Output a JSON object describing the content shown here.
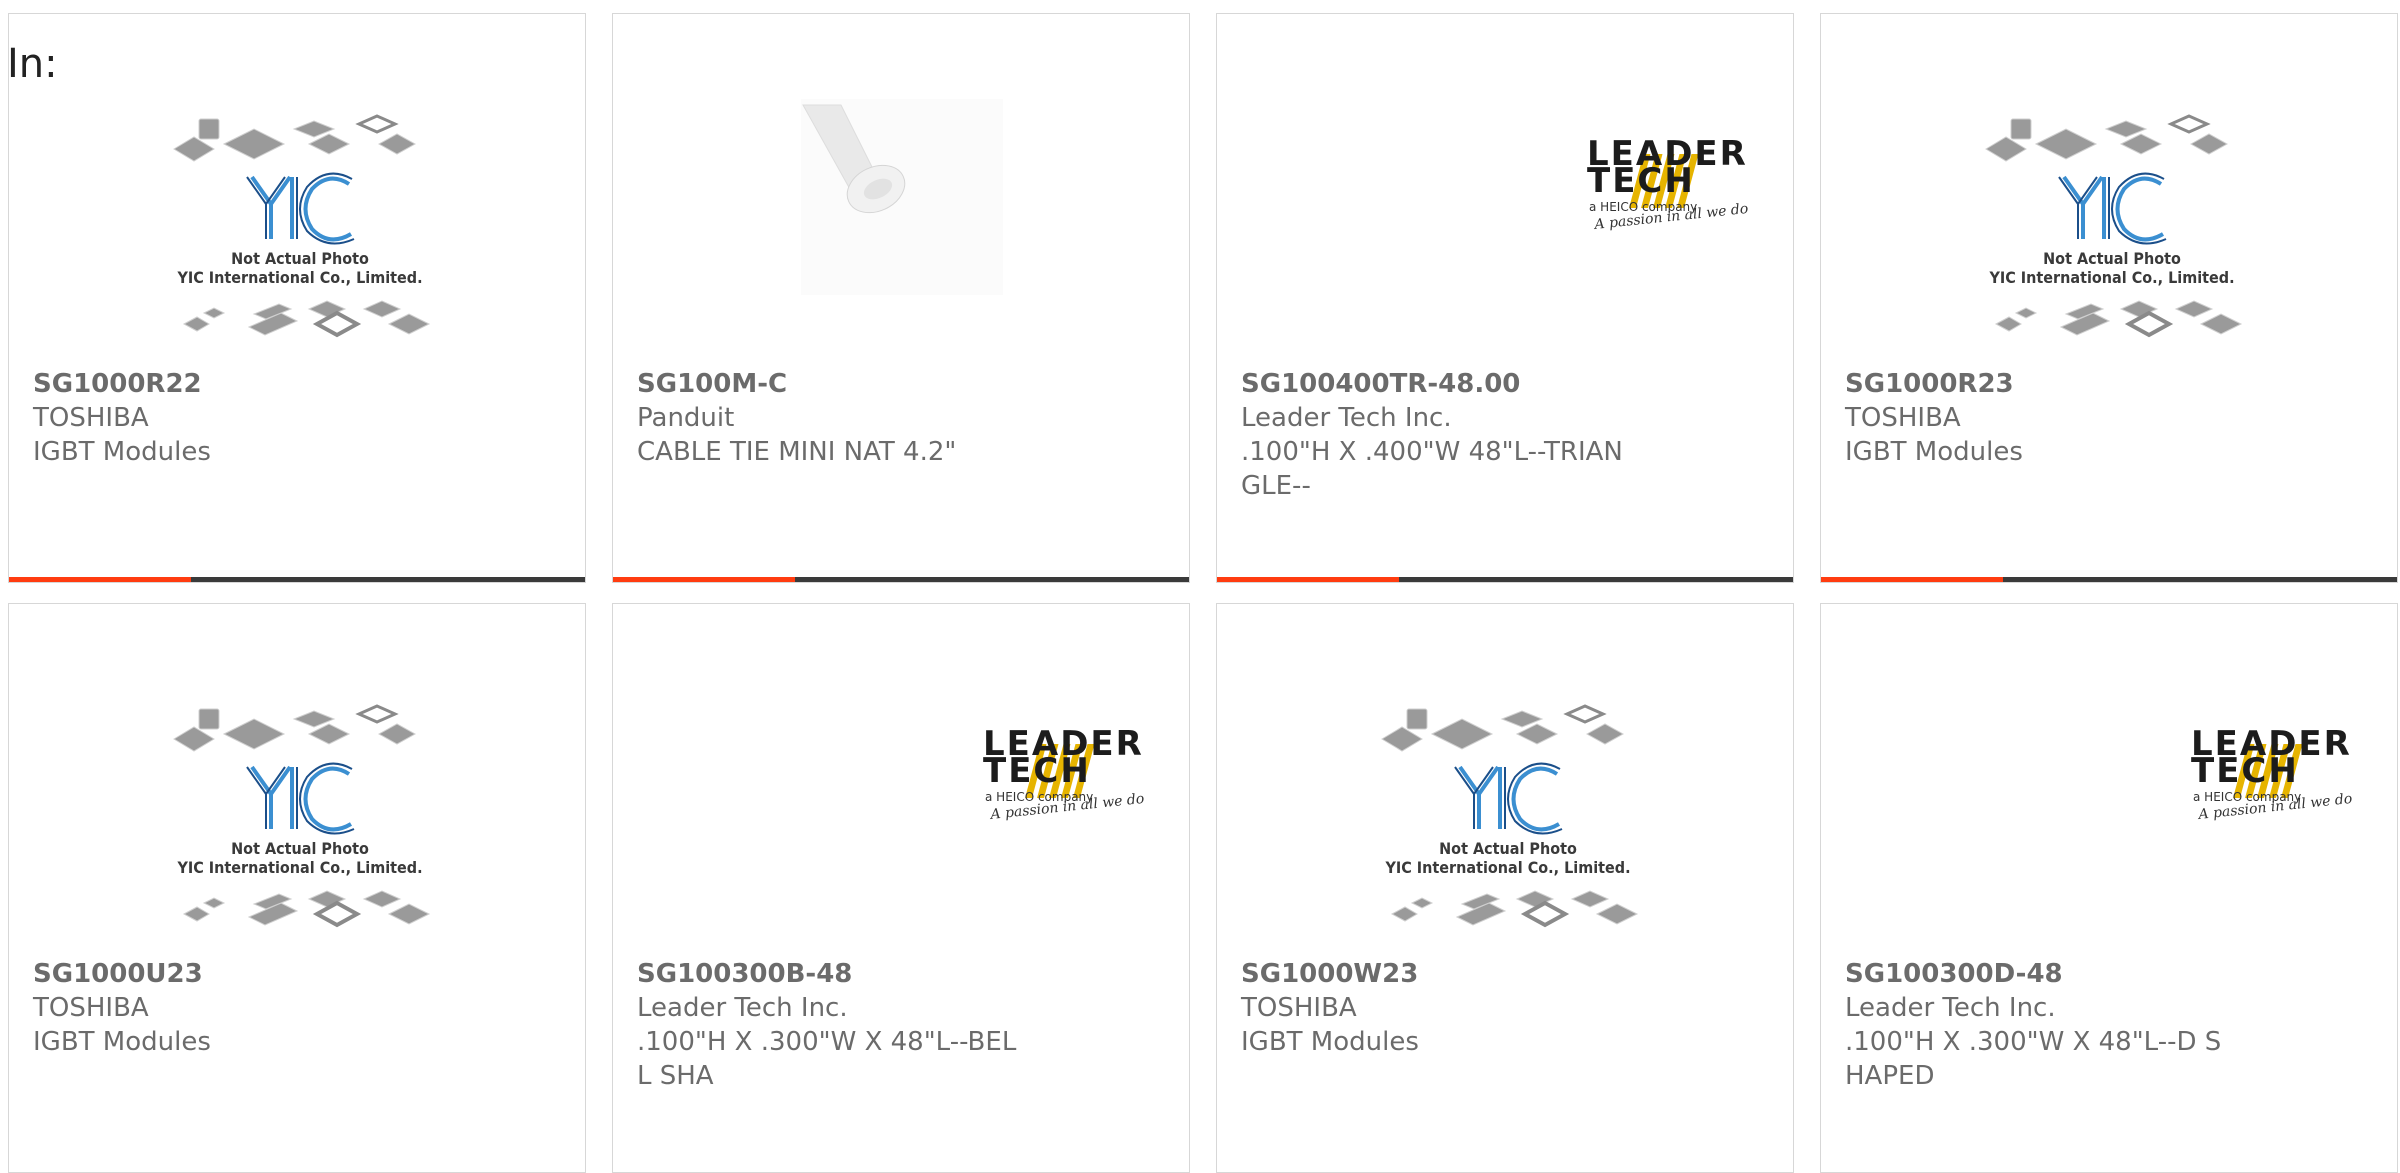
{
  "filter": {
    "label": "In:"
  },
  "colors": {
    "accent": "#ff3c10",
    "bar": "#3a3a3a",
    "text": "#6b6b6b",
    "border": "#d7d7d7"
  },
  "placeholder_image": {
    "line1": "Not Actual Photo",
    "line2": "YIC International Co., Limited."
  },
  "leader_logo": {
    "line1": "LEADER",
    "line2": "TECH",
    "line3": "a HEICO company",
    "line4": "A passion in all we do"
  },
  "products": [
    {
      "part": "SG1000R22",
      "manufacturer": "TOSHIBA",
      "description": "IGBT Modules",
      "image": "yic-placeholder"
    },
    {
      "part": "SG100M-C",
      "manufacturer": "Panduit",
      "description": "CABLE TIE MINI NAT 4.2\"",
      "image": "cable-tie-photo"
    },
    {
      "part": "SG100400TR-48.00",
      "manufacturer": "Leader Tech Inc.",
      "description": ".100\"H X .400\"W 48\"L--TRIANGLE--",
      "image": "leader-tech-logo"
    },
    {
      "part": "SG1000R23",
      "manufacturer": "TOSHIBA",
      "description": "IGBT Modules",
      "image": "yic-placeholder"
    },
    {
      "part": "SG1000U23",
      "manufacturer": "TOSHIBA",
      "description": "IGBT Modules",
      "image": "yic-placeholder"
    },
    {
      "part": "SG100300B-48",
      "manufacturer": "Leader Tech Inc.",
      "description": ".100\"H X .300\"W X 48\"L--BELL SHA",
      "image": "leader-tech-logo"
    },
    {
      "part": "SG1000W23",
      "manufacturer": "TOSHIBA",
      "description": "IGBT Modules",
      "image": "yic-placeholder"
    },
    {
      "part": "SG100300D-48",
      "manufacturer": "Leader Tech Inc.",
      "description": ".100\"H X .300\"W X 48\"L--D SHAPED",
      "image": "leader-tech-logo"
    }
  ]
}
